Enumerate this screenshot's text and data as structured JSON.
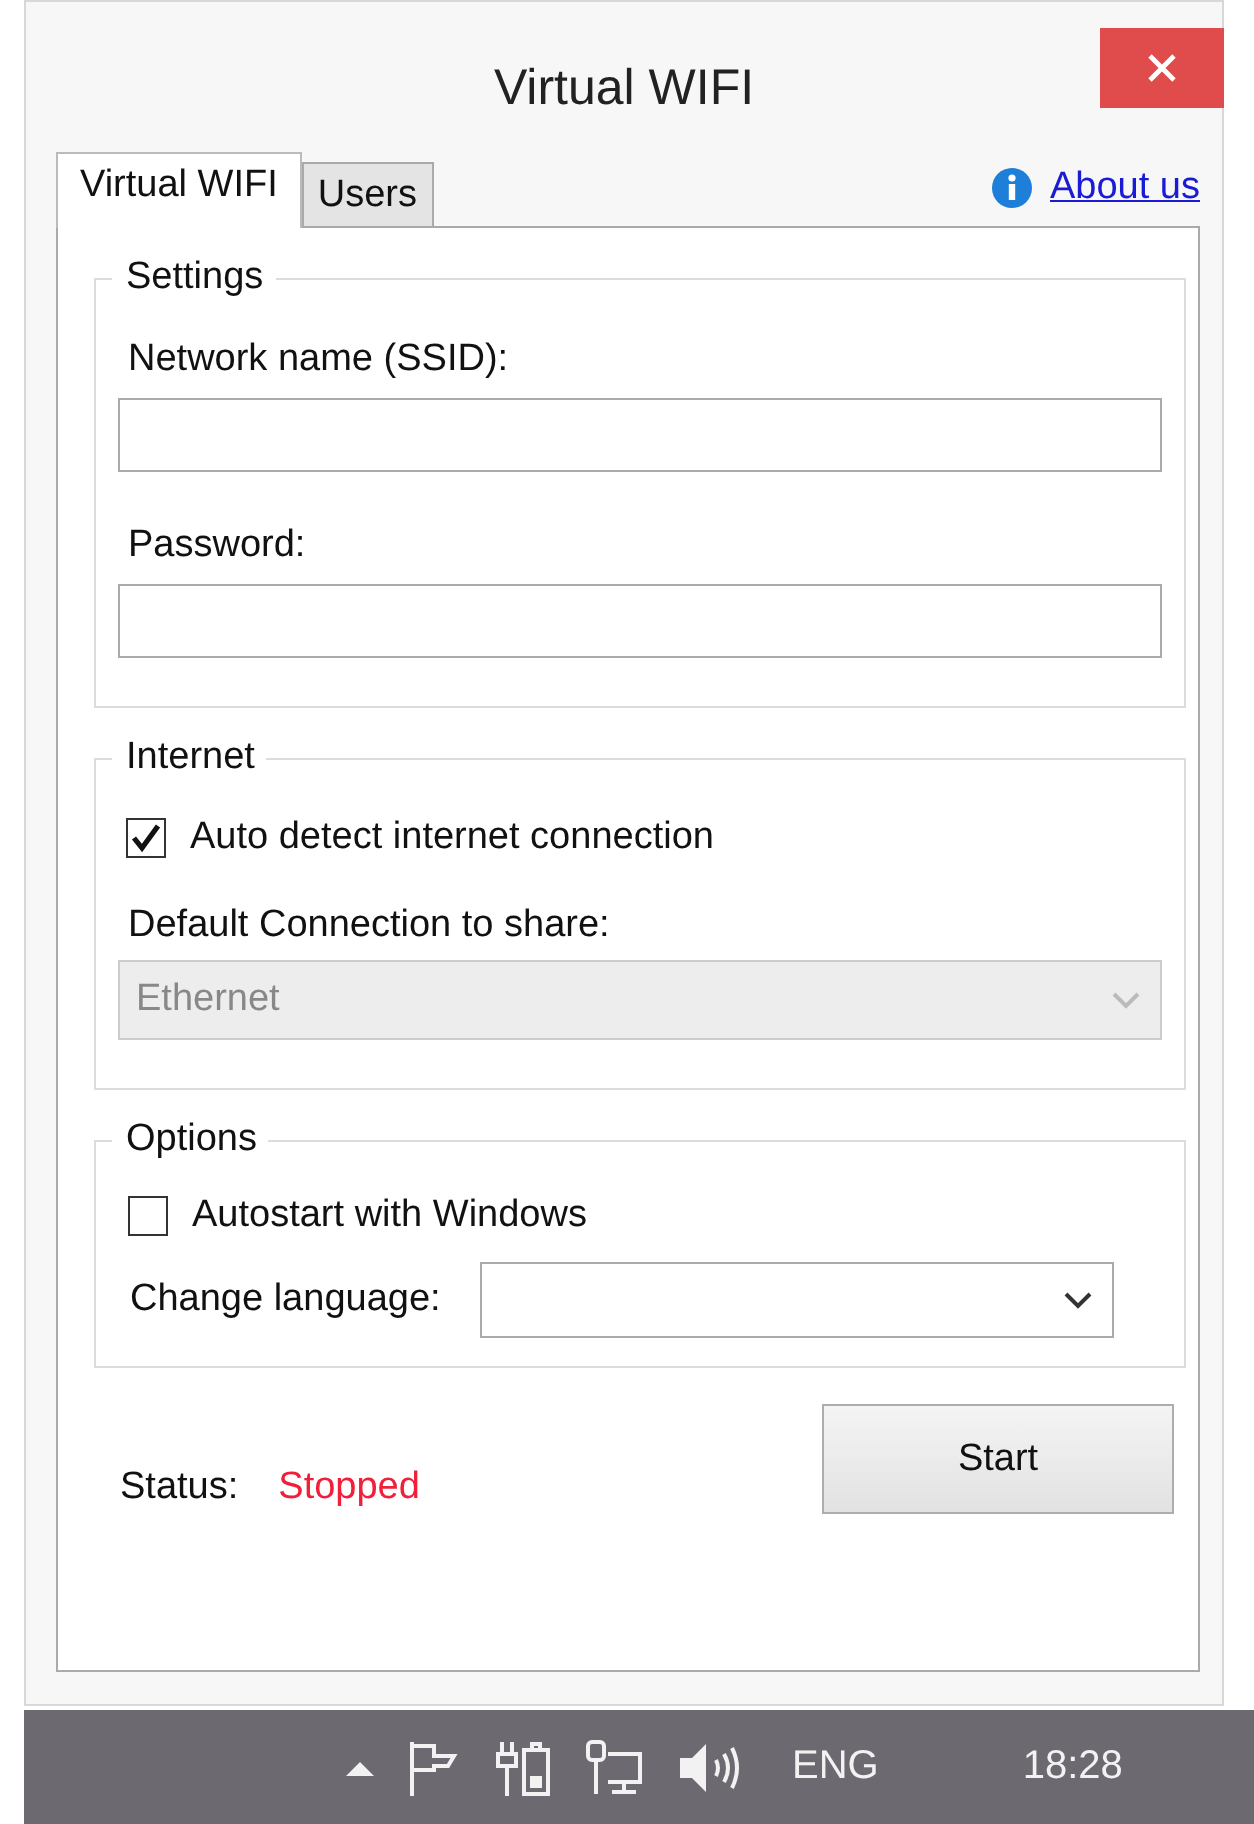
{
  "window": {
    "title": "Virtual WIFI"
  },
  "tabs": [
    {
      "label": "Virtual WIFI",
      "selected": true
    },
    {
      "label": "Users",
      "selected": false
    }
  ],
  "about_link": "About us",
  "groups": [
    {
      "kind": "settings",
      "title": "Settings",
      "fields": [
        {
          "label": "Network name (SSID):"
        },
        {
          "label": "Password:"
        }
      ]
    },
    {
      "kind": "internet",
      "title": "Internet",
      "checkbox": {
        "label": "Auto detect internet connection",
        "checked": true
      },
      "dropdown": {
        "label": "Default Connection to share:",
        "value": "Ethernet",
        "disabled": true
      }
    },
    {
      "kind": "options",
      "title": "Options",
      "checkbox": {
        "label": "Autostart with Windows",
        "checked": false
      },
      "dropdown": {
        "label": "Change language:",
        "disabled": false
      }
    }
  ],
  "status": {
    "label": "Status:",
    "value": "Stopped"
  },
  "start_button": "Start",
  "taskbar": {
    "language": "ENG",
    "time": "18:28"
  }
}
